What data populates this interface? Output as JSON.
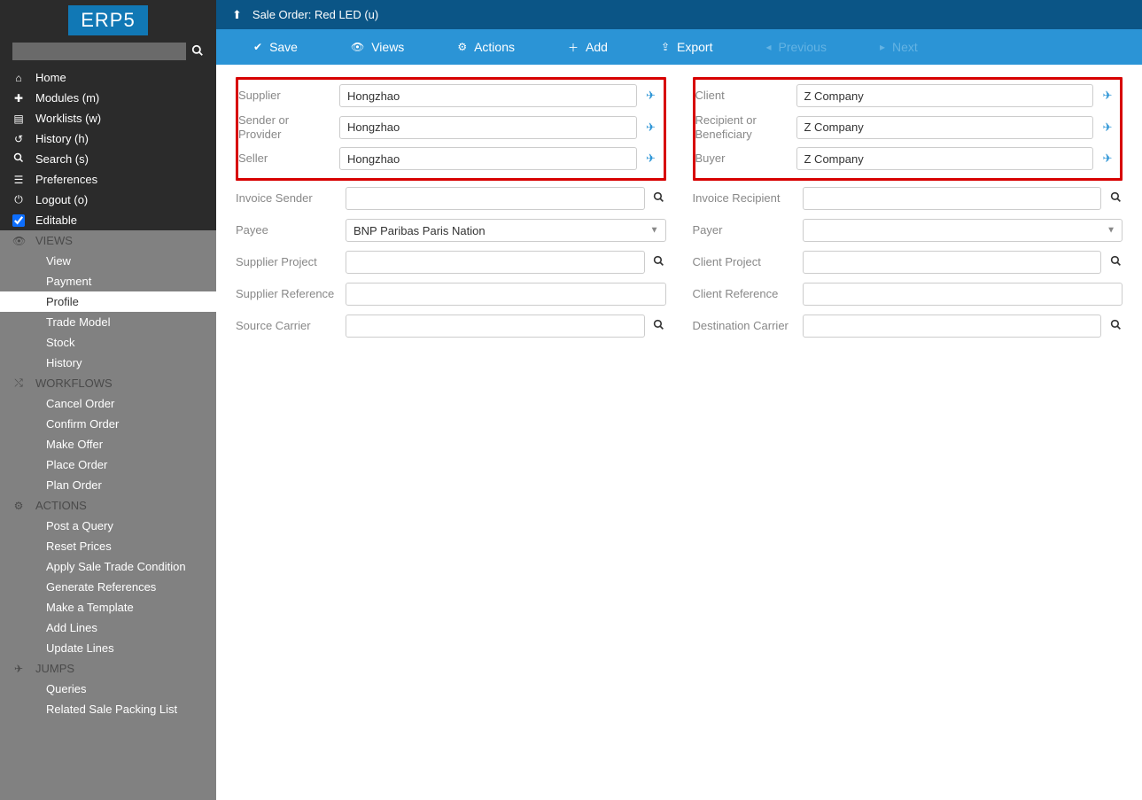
{
  "logo": "ERP5",
  "sidebar": {
    "search_placeholder": "",
    "main": [
      {
        "icon": "home",
        "label": "Home"
      },
      {
        "icon": "puzzle",
        "label": "Modules (m)"
      },
      {
        "icon": "list",
        "label": "Worklists (w)"
      },
      {
        "icon": "history",
        "label": "History (h)"
      },
      {
        "icon": "search",
        "label": "Search (s)"
      },
      {
        "icon": "sliders",
        "label": "Preferences"
      },
      {
        "icon": "power",
        "label": "Logout (o)"
      },
      {
        "icon": "checkbox",
        "label": "Editable"
      }
    ],
    "views_header": "VIEWS",
    "views": [
      "View",
      "Payment",
      "Profile",
      "Trade Model",
      "Stock",
      "History"
    ],
    "workflows_header": "WORKFLOWS",
    "workflows": [
      "Cancel Order",
      "Confirm Order",
      "Make Offer",
      "Place Order",
      "Plan Order"
    ],
    "actions_header": "ACTIONS",
    "actions": [
      "Post a Query",
      "Reset Prices",
      "Apply Sale Trade Condition",
      "Generate References",
      "Make a Template",
      "Add Lines",
      "Update Lines"
    ],
    "jumps_header": "JUMPS",
    "jumps": [
      "Queries",
      "Related Sale Packing List"
    ]
  },
  "breadcrumb": "Sale Order: Red LED (u)",
  "toolbar": {
    "save": "Save",
    "views": "Views",
    "actions": "Actions",
    "add": "Add",
    "export": "Export",
    "previous": "Previous",
    "next": "Next"
  },
  "left": {
    "supplier": {
      "label": "Supplier",
      "value": "Hongzhao"
    },
    "sender": {
      "label": "Sender or Provider",
      "value": "Hongzhao"
    },
    "seller": {
      "label": "Seller",
      "value": "Hongzhao"
    },
    "invoice_sender": {
      "label": "Invoice Sender",
      "value": ""
    },
    "payee": {
      "label": "Payee",
      "value": "BNP Paribas Paris Nation"
    },
    "supplier_project": {
      "label": "Supplier Project",
      "value": ""
    },
    "supplier_reference": {
      "label": "Supplier Reference",
      "value": ""
    },
    "source_carrier": {
      "label": "Source Carrier",
      "value": ""
    }
  },
  "right": {
    "client": {
      "label": "Client",
      "value": "Z Company"
    },
    "recipient": {
      "label": "Recipient or Beneficiary",
      "value": "Z Company"
    },
    "buyer": {
      "label": "Buyer",
      "value": "Z Company"
    },
    "invoice_recipient": {
      "label": "Invoice Recipient",
      "value": ""
    },
    "payer": {
      "label": "Payer",
      "value": ""
    },
    "client_project": {
      "label": "Client Project",
      "value": ""
    },
    "client_reference": {
      "label": "Client Reference",
      "value": ""
    },
    "destination_carrier": {
      "label": "Destination Carrier",
      "value": ""
    }
  }
}
